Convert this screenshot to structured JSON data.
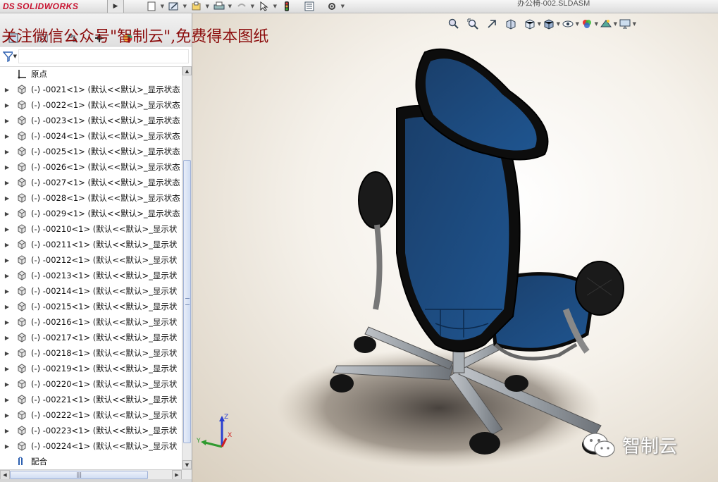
{
  "app": {
    "logo_prefix": "DS",
    "logo_name": "SOLIDWORKS",
    "doc_title": "办公椅-002.SLDASM"
  },
  "watermark": {
    "top_text": "关注微信公众号\"智制云\",免费得本图纸",
    "corner_text": "智制云"
  },
  "toolbar": {
    "icons": [
      "new-icon",
      "sketch-icon",
      "open-icon",
      "print-icon",
      "undo-icon",
      "select-icon",
      "traffic-light-icon",
      "properties-icon",
      "gear-icon"
    ]
  },
  "view_tools": {
    "icons": [
      "zoom-to-fit-icon",
      "zoom-area-icon",
      "previous-view-icon",
      "section-view-icon",
      "view-orientation-icon",
      "display-style-icon",
      "hide-show-icon",
      "edit-appearance-icon",
      "apply-scene-icon",
      "view-settings-icon"
    ]
  },
  "tree": {
    "origin_label": "原点",
    "items": [
      "(-) -0021<1> (默认<<默认>_显示状态",
      "(-) -0022<1> (默认<<默认>_显示状态",
      "(-) -0023<1> (默认<<默认>_显示状态",
      "(-) -0024<1> (默认<<默认>_显示状态",
      "(-) -0025<1> (默认<<默认>_显示状态",
      "(-) -0026<1> (默认<<默认>_显示状态",
      "(-) -0027<1> (默认<<默认>_显示状态",
      "(-) -0028<1> (默认<<默认>_显示状态",
      "(-) -0029<1> (默认<<默认>_显示状态",
      "(-) -00210<1> (默认<<默认>_显示状",
      "(-) -00211<1> (默认<<默认>_显示状",
      "(-) -00212<1> (默认<<默认>_显示状",
      "(-) -00213<1> (默认<<默认>_显示状",
      "(-) -00214<1> (默认<<默认>_显示状",
      "(-) -00215<1> (默认<<默认>_显示状",
      "(-) -00216<1> (默认<<默认>_显示状",
      "(-) -00217<1> (默认<<默认>_显示状",
      "(-) -00218<1> (默认<<默认>_显示状",
      "(-) -00219<1> (默认<<默认>_显示状",
      "(-) -00220<1> (默认<<默认>_显示状",
      "(-) -00221<1> (默认<<默认>_显示状",
      "(-) -00222<1> (默认<<默认>_显示状",
      "(-) -00223<1> (默认<<默认>_显示状",
      "(-) -00224<1> (默认<<默认>_显示状"
    ],
    "mates_label": "配合"
  },
  "triad": {
    "x": "X",
    "y": "Y",
    "z": "Z"
  },
  "colors": {
    "brand_red": "#c8102e",
    "mesh_blue": "#1c4a7c",
    "frame_black": "#111111",
    "watermark_red": "#8b0b0b"
  }
}
